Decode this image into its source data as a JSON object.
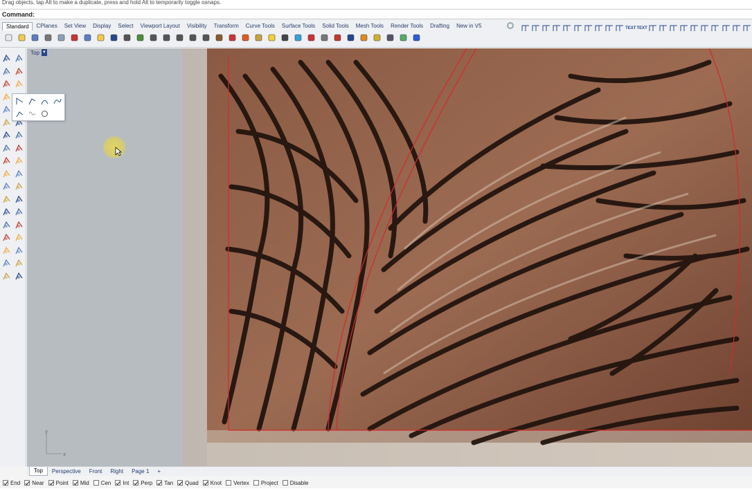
{
  "status_hint": "Drag objects, tap Alt to make a duplicate, press and hold Alt to temporarily toggle osnaps.",
  "command": {
    "label": "Command:"
  },
  "toolbar": {
    "tabs": [
      {
        "label": "Standard",
        "active": true
      },
      {
        "label": "CPlanes"
      },
      {
        "label": "Set View"
      },
      {
        "label": "Display"
      },
      {
        "label": "Select"
      },
      {
        "label": "Viewport Layout"
      },
      {
        "label": "Visibility"
      },
      {
        "label": "Transform"
      },
      {
        "label": "Curve Tools"
      },
      {
        "label": "Surface Tools"
      },
      {
        "label": "Solid Tools"
      },
      {
        "label": "Mesh Tools"
      },
      {
        "label": "Render Tools"
      },
      {
        "label": "Drafting"
      },
      {
        "label": "New in V5"
      }
    ],
    "icons": [
      "new-icon",
      "open-icon",
      "save-icon",
      "print-icon",
      "import-icon",
      "cut-icon",
      "copy-icon",
      "paste-icon",
      "undo-icon",
      "pan-icon",
      "rotate-view-icon",
      "zoom-icon",
      "zoom-window-icon",
      "zoom-extents-icon",
      "zoom-selected-icon",
      "zoom-all-icon",
      "viewport-grid-icon",
      "cplane-icon",
      "shade-icon",
      "point-icon",
      "light-icon",
      "lock-icon",
      "color-icon",
      "layers-icon",
      "material-icon",
      "render-icon",
      "sphere-icon",
      "mesh-icon",
      "environment-icon",
      "settings-icon",
      "options-icon",
      "help-icon"
    ]
  },
  "snap_toolbar": {
    "icons": [
      "snap-end-icon",
      "snap-line-icon",
      "snap-rect-icon",
      "snap-curve-icon",
      "snap-arc-icon",
      "snap-cross-icon",
      "snap-select-icon",
      "snap-bend-icon",
      "snap-twist-icon",
      "snap-check-icon",
      "text-icon",
      "text-alt-icon",
      "dimension-icon",
      "leader-icon",
      "section-icon",
      "grid-icon",
      "arrow-icon",
      "flow-icon",
      "zigzag-icon",
      "globe-icon",
      "layer-toggle-icon",
      "extra-icon"
    ],
    "text_labels": [
      "TEXT",
      "TEXT"
    ]
  },
  "viewport": {
    "title": "Top",
    "axis_y": "y",
    "axis_x": "x"
  },
  "viewport_tabs": [
    {
      "label": "Top",
      "active": true
    },
    {
      "label": "Perspective"
    },
    {
      "label": "Front"
    },
    {
      "label": "Right"
    },
    {
      "label": "Page 1"
    },
    {
      "label": "+"
    }
  ],
  "osnaps": [
    {
      "label": "End",
      "checked": true
    },
    {
      "label": "Near",
      "checked": true
    },
    {
      "label": "Point",
      "checked": true
    },
    {
      "label": "Mid",
      "checked": true
    },
    {
      "label": "Cen",
      "checked": false
    },
    {
      "label": "Int",
      "checked": true
    },
    {
      "label": "Perp",
      "checked": true
    },
    {
      "label": "Tan",
      "checked": true
    },
    {
      "label": "Quad",
      "checked": true
    },
    {
      "label": "Knot",
      "checked": true
    },
    {
      "label": "Vertex",
      "checked": false
    },
    {
      "label": "Project",
      "checked": false
    },
    {
      "label": "Disable",
      "checked": false
    }
  ],
  "colors": {
    "accent": "#26478c",
    "curve_red": "#d42a2a",
    "wood": "#7a4a34",
    "viewport_bg": "#b7bcc1"
  }
}
